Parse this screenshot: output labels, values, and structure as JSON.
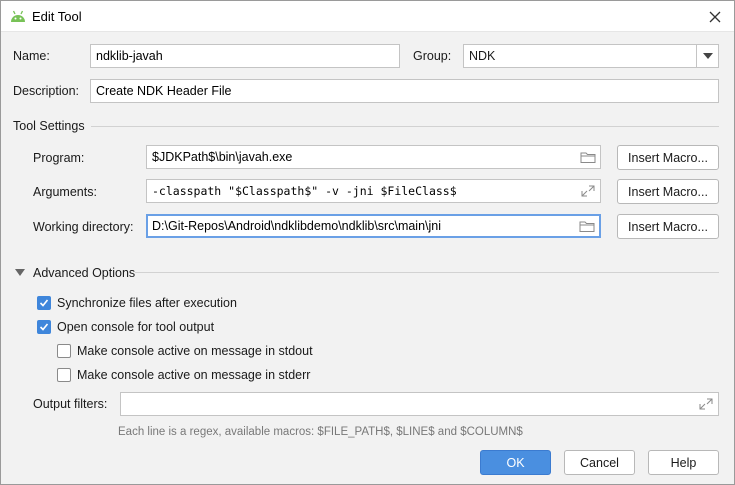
{
  "window": {
    "title": "Edit Tool",
    "title_icon": "android-icon",
    "close_icon": "close-icon"
  },
  "form": {
    "name_label": "Name:",
    "name_value": "ndklib-javah",
    "group_label": "Group:",
    "group_value": "NDK",
    "description_label": "Description:",
    "description_value": "Create NDK Header File"
  },
  "tool_settings": {
    "section_label": "Tool Settings",
    "program_label": "Program:",
    "program_value": "$JDKPath$\\bin\\javah.exe",
    "arguments_label": "Arguments:",
    "arguments_value": "-classpath \"$Classpath$\" -v -jni $FileClass$",
    "working_dir_label": "Working directory:",
    "working_dir_value": "D:\\Git-Repos\\Android\\ndklibdemo\\ndklib\\src\\main\\jni",
    "insert_macro_label": "Insert Macro..."
  },
  "advanced": {
    "section_label": "Advanced Options",
    "options": [
      {
        "label": "Synchronize files after execution",
        "checked": true
      },
      {
        "label": "Open console for tool output",
        "checked": true
      },
      {
        "label": "Make console active on message in stdout",
        "checked": false
      },
      {
        "label": "Make console active on message in stderr",
        "checked": false
      }
    ],
    "output_filters_label": "Output filters:",
    "output_filters_value": "",
    "hint": "Each line is a regex, available macros: $FILE_PATH$, $LINE$ and $COLUMN$"
  },
  "footer": {
    "ok_label": "OK",
    "cancel_label": "Cancel",
    "help_label": "Help"
  },
  "colors": {
    "accent": "#4a8fe0",
    "checkbox": "#3f86db",
    "android_green": "#78c257",
    "focus_border": "#6aa0e6"
  }
}
